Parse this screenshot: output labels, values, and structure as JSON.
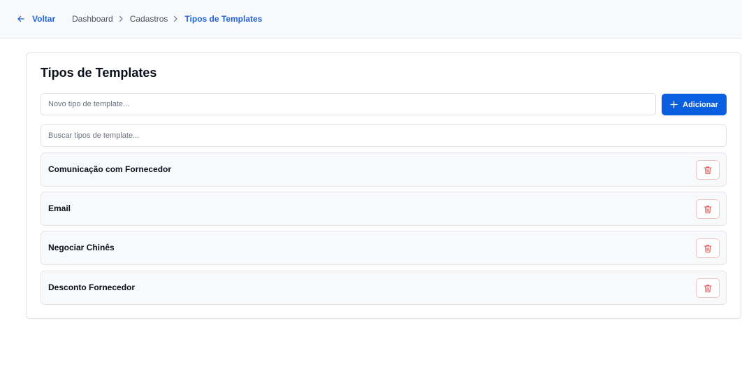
{
  "header": {
    "back_label": "Voltar",
    "breadcrumb": [
      "Dashboard",
      "Cadastros",
      "Tipos de Templates"
    ]
  },
  "main": {
    "title": "Tipos de Templates",
    "new_input": {
      "placeholder": "Novo tipo de template...",
      "value": ""
    },
    "add_button_label": "Adicionar",
    "search_input": {
      "placeholder": "Buscar tipos de template...",
      "value": ""
    },
    "items": [
      {
        "label": "Comunicação com Fornecedor"
      },
      {
        "label": "Email"
      },
      {
        "label": "Negociar Chinês"
      },
      {
        "label": "Desconto Fornecedor"
      }
    ]
  },
  "icons": {
    "back": "arrow-left-icon",
    "separator": "chevron-right-icon",
    "add": "plus-icon",
    "delete": "trash-icon"
  },
  "colors": {
    "accent": "#0a5fe0",
    "link": "#1f63d6",
    "danger": "#e05252",
    "danger_border": "#f2c3c3",
    "row_bg": "#f8f9fb"
  }
}
